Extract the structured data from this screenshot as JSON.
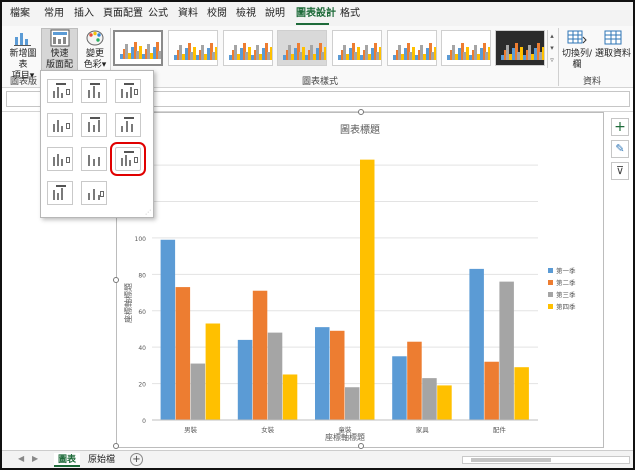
{
  "tabs": [
    "檔案",
    "常用",
    "插入",
    "頁面配置",
    "公式",
    "資料",
    "校閱",
    "檢視",
    "說明",
    "圖表設計",
    "格式"
  ],
  "active_tab": "圖表設計",
  "ribbon": {
    "add_element_line1": "新增圖表",
    "add_element_line2": "項目",
    "quick_layout_line1": "快速",
    "quick_layout_line2": "版面配置",
    "change_colors_line1": "變更",
    "change_colors_line2": "色彩",
    "switch_row_col": "切換列/欄",
    "select_data": "選取資料",
    "group_layouts": "圖表版",
    "group_styles": "圖表樣式",
    "group_data": "資料",
    "dropdown_arrow": "▾"
  },
  "chart": {
    "title": "圖表標題",
    "side_buttons": [
      "+",
      "✎",
      "⊽"
    ]
  },
  "chart_data": {
    "type": "bar",
    "title": "圖表標題",
    "xlabel": "座標軸標題",
    "ylabel": "座標軸標題",
    "categories": [
      "男裝",
      "女裝",
      "童裝",
      "家具",
      "配件"
    ],
    "series": [
      {
        "name": "第一季",
        "color": "#5b9bd5",
        "values": [
          99,
          44,
          51,
          35,
          83
        ]
      },
      {
        "name": "第二季",
        "color": "#ed7d31",
        "values": [
          73,
          71,
          49,
          43,
          32
        ]
      },
      {
        "name": "第三季",
        "color": "#a5a5a5",
        "values": [
          31,
          48,
          18,
          23,
          76
        ]
      },
      {
        "name": "第四季",
        "color": "#ffc000",
        "values": [
          53,
          25,
          143,
          19,
          29
        ]
      }
    ],
    "yticks": [
      0,
      20,
      40,
      60,
      80,
      100
    ],
    "ylim": [
      0,
      145
    ],
    "grid": true,
    "legend_position": "right"
  },
  "sheets": [
    "圖表",
    "原始檔"
  ],
  "active_sheet": "圖表",
  "add_sheet": "+",
  "nav": [
    "◀",
    "▶"
  ]
}
